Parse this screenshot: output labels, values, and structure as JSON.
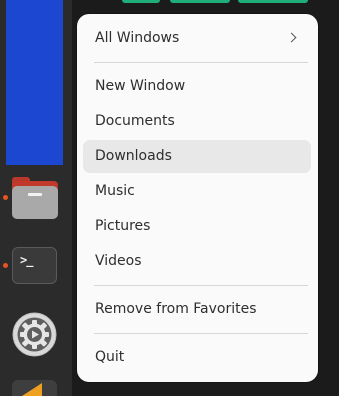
{
  "dock": {
    "items": [
      {
        "name": "files",
        "icon": "folder-icon",
        "running": true
      },
      {
        "name": "terminal",
        "icon": "terminal-icon",
        "prompt": ">_",
        "running": true
      },
      {
        "name": "settings",
        "icon": "gear-icon",
        "running": false
      },
      {
        "name": "app",
        "icon": "app-icon",
        "running": false
      }
    ],
    "indicator_color": "#e95420",
    "window_preview_color": "#1c47d0"
  },
  "menu": {
    "submenu": {
      "label": "All Windows",
      "icon": "chevron-right-icon"
    },
    "places": [
      {
        "label": "New Window"
      },
      {
        "label": "Documents"
      },
      {
        "label": "Downloads",
        "hovered": true
      },
      {
        "label": "Music"
      },
      {
        "label": "Pictures"
      },
      {
        "label": "Videos"
      }
    ],
    "remove_favorites": "Remove from Favorites",
    "quit": "Quit"
  }
}
